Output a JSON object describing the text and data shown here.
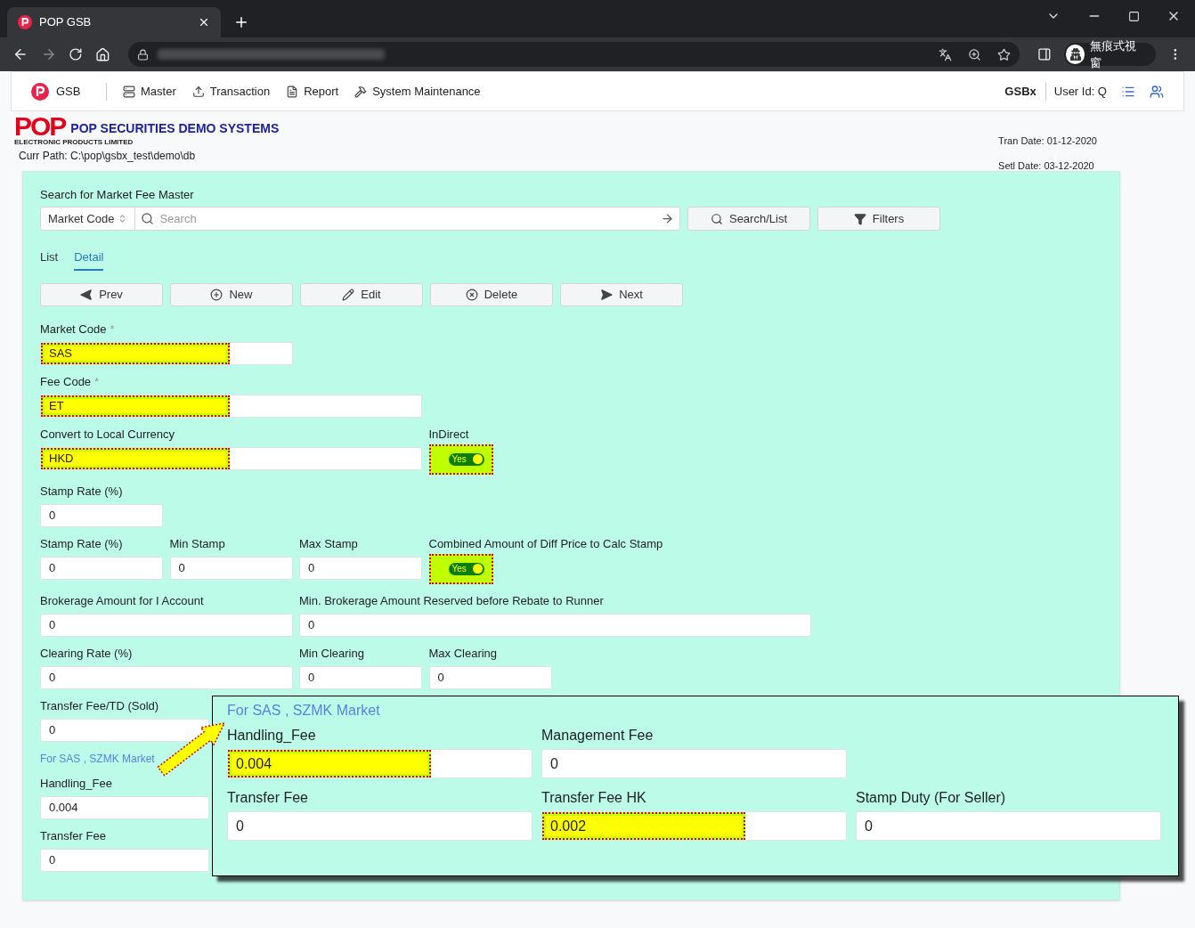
{
  "browser": {
    "tab_title": "POP GSB",
    "profile_label": "無痕式視窗"
  },
  "navbar": {
    "brand": "GSB",
    "menu": [
      {
        "label": "Master",
        "kind": "master"
      },
      {
        "label": "Transaction",
        "kind": "transaction"
      },
      {
        "label": "Report",
        "kind": "report"
      },
      {
        "label": "System Maintenance",
        "kind": "maintenance"
      }
    ],
    "app_name": "GSBx",
    "user": "User Id: Q"
  },
  "header": {
    "logo": "POP",
    "logo_tagline": "ELECTRONIC PRODUCTS LIMITED",
    "title": "POP SECURITIES DEMO SYSTEMS",
    "curr_path": "Curr Path: C:\\pop\\gsbx_test\\demo\\db",
    "tran_date": "Tran Date: 01-12-2020",
    "setl_date": "Setl Date: 03-12-2020"
  },
  "search": {
    "title": "Search for Market Fee Master",
    "field_selector": "Market Code",
    "placeholder": "Search",
    "buttons": [
      {
        "label": "Search/List",
        "kind": "search"
      },
      {
        "label": "Filters",
        "kind": "filter"
      }
    ]
  },
  "view_tabs": [
    {
      "label": "List",
      "selected": false
    },
    {
      "label": "Detail",
      "selected": true
    }
  ],
  "actions": [
    {
      "label": "Prev",
      "kind": "prev"
    },
    {
      "label": "New",
      "kind": "new"
    },
    {
      "label": "Edit",
      "kind": "edit"
    },
    {
      "label": "Delete",
      "kind": "delete"
    },
    {
      "label": "Next",
      "kind": "next"
    }
  ],
  "form_rows": [
    [
      {
        "kind": "input",
        "label": "Market Code",
        "required_mark": "*",
        "value": "SAS",
        "highlighted": true
      }
    ],
    [
      {
        "kind": "input",
        "label": "Fee Code",
        "required_mark": "*",
        "value": "ET",
        "highlighted": true
      }
    ],
    [
      {
        "kind": "input",
        "label": "Convert to Local Currency",
        "value": "HKD",
        "highlighted": true
      },
      {
        "kind": "toggle",
        "label": "InDirect",
        "on": true,
        "text": "Yes",
        "highlighted": true
      }
    ],
    [
      {
        "kind": "input",
        "label": "Stamp Rate (%)",
        "value": "0",
        "highlighted": false
      }
    ],
    [
      {
        "kind": "input",
        "label": "Stamp Rate (%)",
        "value": "0",
        "highlighted": false
      },
      {
        "kind": "input",
        "label": "Min Stamp",
        "value": "0",
        "highlighted": false
      },
      {
        "kind": "input",
        "label": "Max Stamp",
        "value": "0",
        "highlighted": false
      },
      {
        "kind": "toggle",
        "label": "Combined Amount of Diff Price to Calc Stamp",
        "on": true,
        "text": "Yes",
        "highlighted": true
      }
    ],
    [
      {
        "kind": "input",
        "label": "Brokerage Amount for I Account",
        "value": "0",
        "highlighted": false
      },
      {
        "kind": "input",
        "label": "Min. Brokerage Amount Reserved before Rebate to Runner",
        "value": "0",
        "highlighted": false
      }
    ],
    [
      {
        "kind": "input",
        "label": "Clearing Rate (%)",
        "value": "0",
        "highlighted": false
      },
      {
        "kind": "input",
        "label": "Min Clearing",
        "value": "0",
        "highlighted": false
      },
      {
        "kind": "input",
        "label": "Max Clearing",
        "value": "0",
        "highlighted": false
      }
    ],
    [
      {
        "kind": "input",
        "label": "Transfer Fee/TD (Sold)",
        "value": "0",
        "highlighted": false
      }
    ],
    [
      {
        "kind": "link",
        "label": "For SAS , SZMK Market"
      }
    ],
    [
      {
        "kind": "input",
        "label": "Handling_Fee",
        "value": "0.004",
        "highlighted": false
      }
    ],
    [
      {
        "kind": "input",
        "label": "Transfer Fee",
        "value": "0",
        "highlighted": false
      }
    ]
  ],
  "zoom_inset": {
    "heading": "For SAS , SZMK Market",
    "rows": [
      [
        {
          "label": "Handling_Fee",
          "value": "0.004",
          "highlighted": true
        },
        {
          "label": "Management Fee",
          "value": "0",
          "highlighted": false
        }
      ],
      [
        {
          "label": "Transfer Fee",
          "value": "0",
          "highlighted": false
        },
        {
          "label": "Transfer Fee HK",
          "value": "0.002",
          "highlighted": true
        },
        {
          "label": "Stamp Duty (For Seller)",
          "value": "0",
          "highlighted": false
        }
      ]
    ]
  }
}
